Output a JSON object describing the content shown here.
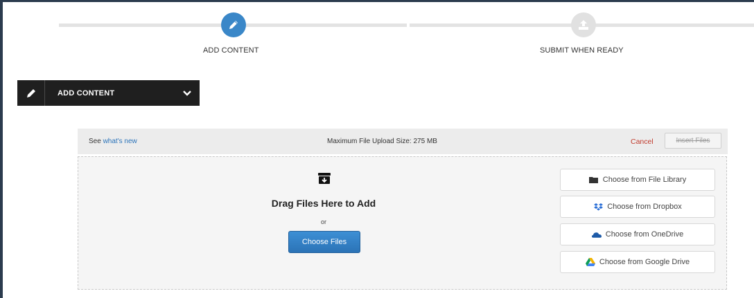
{
  "stepper": {
    "steps": [
      {
        "label": "ADD CONTENT",
        "icon": "pencil-icon",
        "state": "active"
      },
      {
        "label": "SUBMIT WHEN READY",
        "icon": "upload-icon",
        "state": "inactive"
      }
    ],
    "active_color": "#3a87c8",
    "inactive_color": "#e1e1e1"
  },
  "section": {
    "title": "ADD CONTENT",
    "icon": "pencil-icon",
    "toggle_icon": "chevron-down-icon"
  },
  "upload_bar": {
    "see_prefix": "See",
    "whats_new_link": "what's new",
    "max_size": "Maximum File Upload Size: 275 MB",
    "cancel_label": "Cancel",
    "insert_label": "Insert Files"
  },
  "dropzone": {
    "icon": "archive-download-icon",
    "title": "Drag Files Here to Add",
    "or_text": "or",
    "choose_files_label": "Choose Files",
    "sources": [
      {
        "label": "Choose from File Library",
        "icon": "folder-icon"
      },
      {
        "label": "Choose from Dropbox",
        "icon": "dropbox-icon"
      },
      {
        "label": "Choose from OneDrive",
        "icon": "onedrive-icon"
      },
      {
        "label": "Choose from Google Drive",
        "icon": "google-drive-icon"
      }
    ]
  },
  "colors": {
    "link": "#2a73b9",
    "cancel": "#c0392b",
    "primary_button": "#2b73b6",
    "dark_bar": "#1f1f1f"
  }
}
